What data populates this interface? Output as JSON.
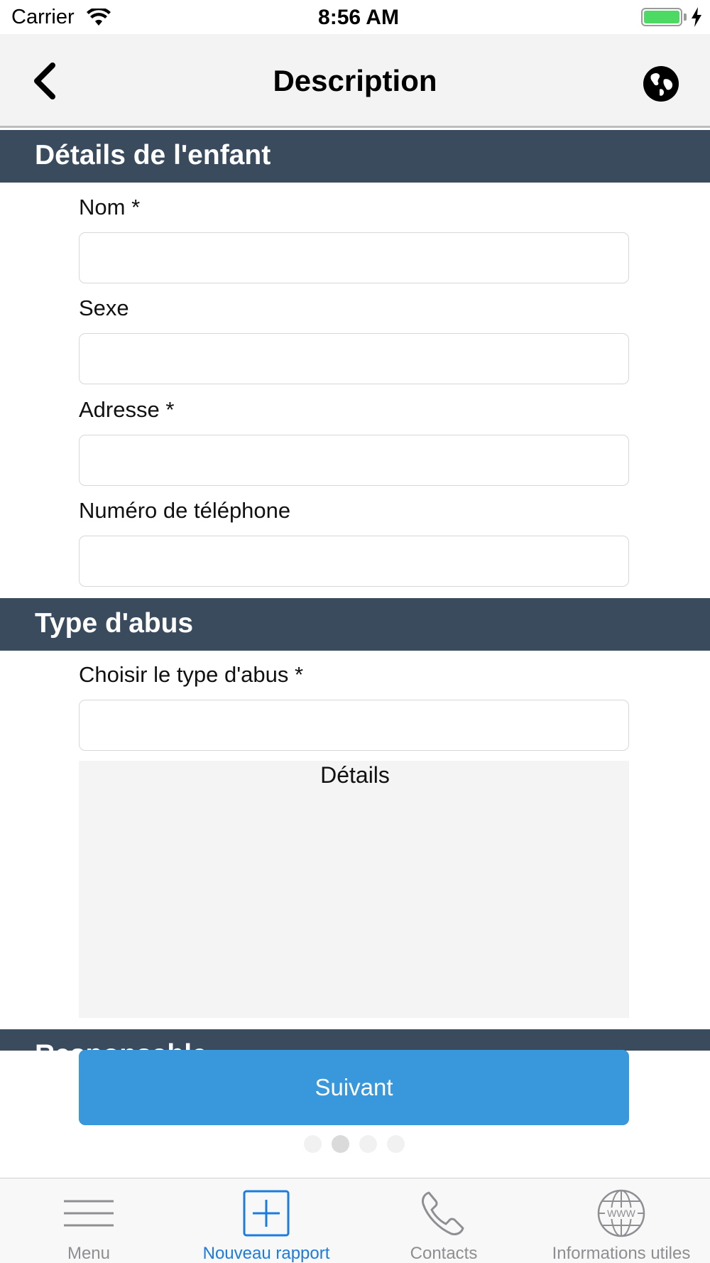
{
  "status_bar": {
    "carrier": "Carrier",
    "time": "8:56 AM",
    "battery_color": "#4cd964"
  },
  "nav": {
    "title": "Description",
    "back_icon": "chevron-left-icon",
    "right_icon": "globe-icon"
  },
  "sections": {
    "child_details": {
      "title": "Détails de l'enfant",
      "fields": {
        "name": {
          "label": "Nom *",
          "value": "",
          "placeholder": ""
        },
        "sex": {
          "label": "Sexe",
          "value": "",
          "placeholder": ""
        },
        "address": {
          "label": "Adresse *",
          "value": "",
          "placeholder": ""
        },
        "phone": {
          "label": "Numéro de téléphone",
          "value": "",
          "placeholder": ""
        }
      }
    },
    "abuse_type": {
      "title": "Type d'abus",
      "fields": {
        "type": {
          "label": "Choisir le type d'abus *",
          "value": "",
          "placeholder": ""
        }
      },
      "details_label": "Détails"
    },
    "next_section_title": "Responsable"
  },
  "next_button": {
    "label": "Suivant",
    "color": "#3898db"
  },
  "pagination": {
    "total": 4,
    "active_index": 1
  },
  "tab_bar": {
    "active_color": "#1a7ce0",
    "items": [
      {
        "label": "Menu",
        "icon": "menu-icon",
        "active": false
      },
      {
        "label": "Nouveau rapport",
        "icon": "add-report-icon",
        "active": true
      },
      {
        "label": "Contacts",
        "icon": "phone-icon",
        "active": false
      },
      {
        "label": "Informations utiles",
        "icon": "www-globe-icon",
        "active": false
      }
    ]
  },
  "colors": {
    "section_header_bg": "#3a4b5e",
    "nav_bg": "#f3f3f3"
  }
}
